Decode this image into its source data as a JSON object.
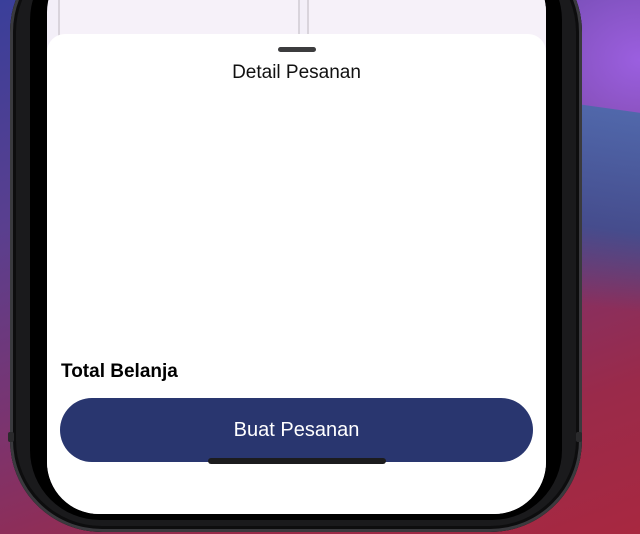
{
  "sheet": {
    "title": "Detail Pesanan",
    "total_label": "Total Belanja",
    "order_button_label": "Buat Pesanan"
  },
  "colors": {
    "primary_button": "#29366f",
    "sheet_background": "#ffffff",
    "background_card": "#f6f1f9"
  }
}
